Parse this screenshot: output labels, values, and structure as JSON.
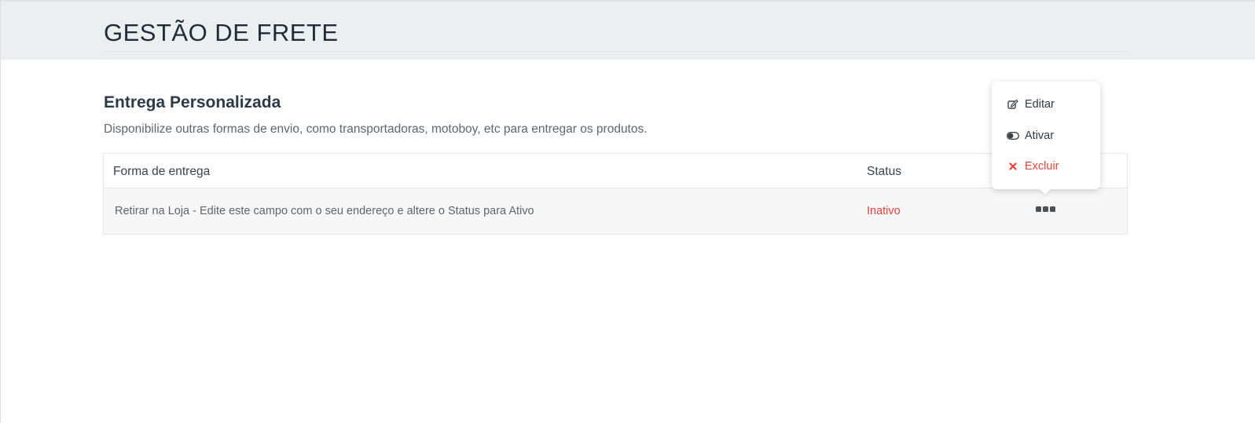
{
  "header": {
    "title": "GESTÃO DE FRETE"
  },
  "section": {
    "title": "Entrega Personalizada",
    "description": "Disponibilize outras formas de envio, como transportadoras, motoboy, etc para entregar os produtos."
  },
  "table": {
    "columns": [
      "Forma de entrega",
      "Status"
    ],
    "rows": [
      {
        "forma": "Retirar na Loja - Edite este campo com o seu endereço e altere o Status para Ativo",
        "status": "Inativo"
      }
    ]
  },
  "actions_menu": {
    "items": [
      {
        "label": "Editar",
        "icon": "edit-icon"
      },
      {
        "label": "Ativar",
        "icon": "toggle-icon"
      },
      {
        "label": "Excluir",
        "icon": "close-icon"
      }
    ],
    "trigger_icon": "more-dots-icon"
  },
  "colors": {
    "header_bg": "#eceff0",
    "status_inactive": "#e8403a",
    "danger": "#e8403a",
    "row_bg": "#f7f7f7"
  }
}
